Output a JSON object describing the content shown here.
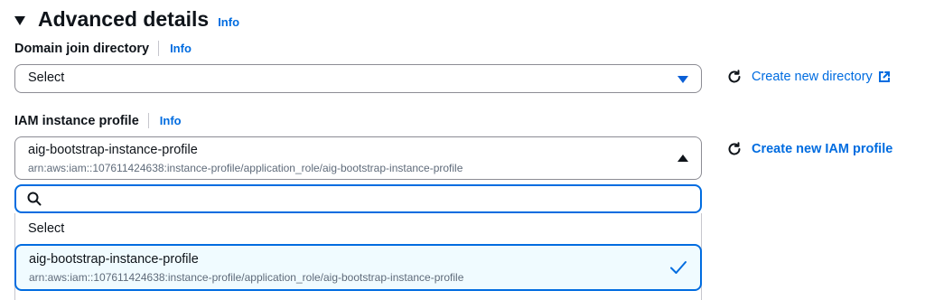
{
  "section": {
    "title": "Advanced details",
    "info": "Info"
  },
  "domain_join": {
    "label": "Domain join directory",
    "info": "Info",
    "select_value": "Select",
    "create_link": "Create new directory"
  },
  "iam_profile": {
    "label": "IAM instance profile",
    "info": "Info",
    "selected_name": "aig-bootstrap-instance-profile",
    "selected_arn": "arn:aws:iam::107611424638:instance-profile/application_role/aig-bootstrap-instance-profile",
    "create_link": "Create new IAM profile",
    "search_value": "",
    "options": [
      {
        "label": "Select"
      },
      {
        "label": "aig-bootstrap-instance-profile",
        "description": "arn:aws:iam::107611424638:instance-profile/application_role/aig-bootstrap-instance-profile",
        "selected": true
      }
    ]
  },
  "icons": {
    "section_toggle": "caret-down-icon",
    "refresh": "refresh-icon",
    "external": "external-link-icon",
    "search": "search-icon",
    "check": "check-icon"
  },
  "colors": {
    "link": "#006ce0",
    "selected_bg": "#f0fbff",
    "text": "#0f141a",
    "secondary_text": "#5f6b7a"
  }
}
